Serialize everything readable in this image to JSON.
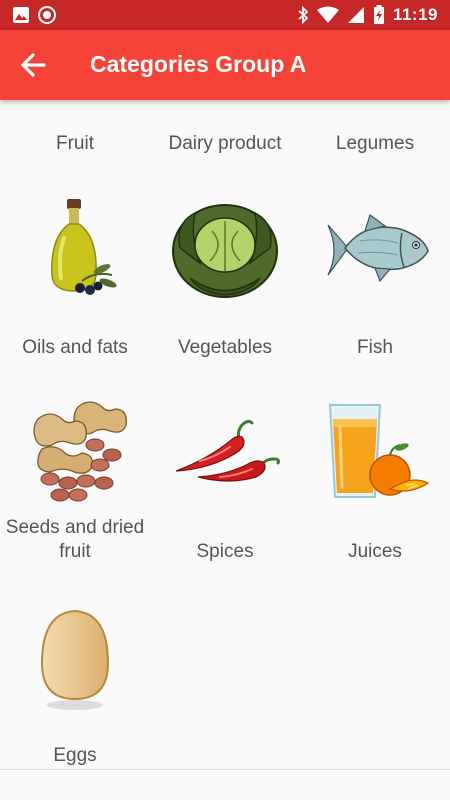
{
  "status_bar": {
    "time": "11:19",
    "icons": [
      "image-icon",
      "record-icon",
      "bluetooth-icon",
      "wifi-icon",
      "signal-icon",
      "battery-charging-icon"
    ]
  },
  "app_bar": {
    "title": "Categories Group A",
    "back_icon": "arrow-left-icon"
  },
  "categories": [
    {
      "label": "Fruit",
      "image": ""
    },
    {
      "label": "Dairy product",
      "image": ""
    },
    {
      "label": "Legumes",
      "image": ""
    },
    {
      "label": "Oils and fats",
      "image": "olive-oil-bottle"
    },
    {
      "label": "Vegetables",
      "image": "cabbage"
    },
    {
      "label": "Fish",
      "image": "fish"
    },
    {
      "label": "Seeds and dried fruit",
      "image": "peanuts"
    },
    {
      "label": "Spices",
      "image": "chili-peppers"
    },
    {
      "label": "Juices",
      "image": "orange-juice"
    },
    {
      "label": "Eggs",
      "image": "egg"
    }
  ],
  "colors": {
    "status_bar": "#c62828",
    "app_bar": "#f44336",
    "background": "#fafafa",
    "label_text": "#555555"
  }
}
